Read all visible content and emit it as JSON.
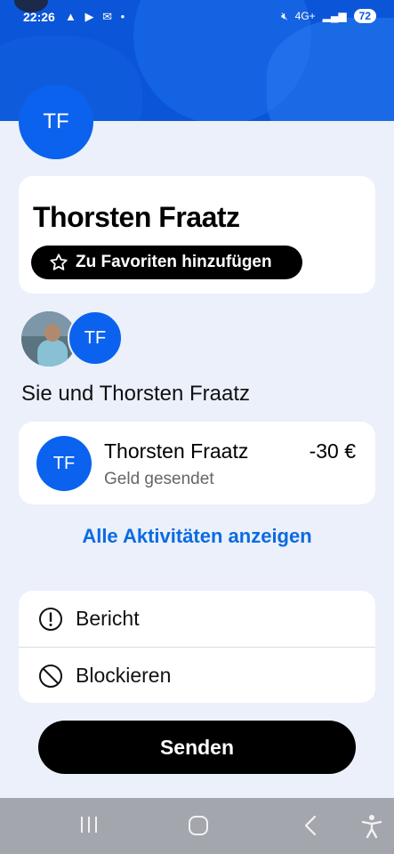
{
  "status_bar": {
    "time": "22:26",
    "notif_icons": "▲ ▶ ✉ •",
    "network": "4G+",
    "battery": "72"
  },
  "profile": {
    "initials": "TF",
    "name": "Thorsten Fraatz",
    "favorite_label": "Zu Favoriten hinzufügen"
  },
  "shared": {
    "title": "Sie und Thorsten Fraatz",
    "avatar_initials": "TF"
  },
  "transaction": {
    "initials": "TF",
    "name": "Thorsten Fraatz",
    "subtitle": "Geld gesendet",
    "amount": "-30 €"
  },
  "all_activity_label": "Alle Aktivitäten anzeigen",
  "actions": {
    "report_label": "Bericht",
    "block_label": "Blockieren"
  },
  "send_label": "Senden",
  "colors": {
    "brand_blue": "#0b55d9",
    "avatar_blue": "#0b62ee",
    "link_blue": "#0b6be0",
    "background": "#ebf0fb"
  }
}
